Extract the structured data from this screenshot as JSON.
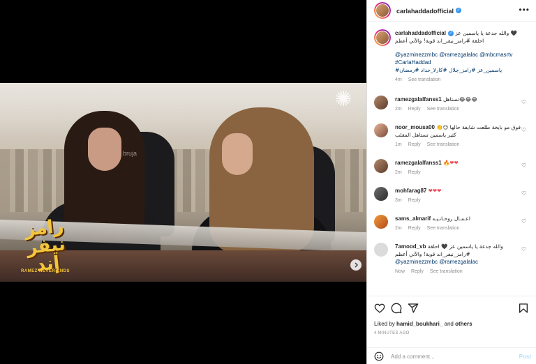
{
  "post": {
    "username": "carlahaddadofficial",
    "verified": true,
    "media": {
      "show_title": "رامز نيفر إند",
      "show_subtitle": "RAMEZ NEVER ENDS",
      "watermark_text": "bruja"
    }
  },
  "caption": {
    "username": "carlahaddadofficial",
    "line1": "والله جدعة يا ياسمين عز 🖤",
    "line2": "احلقة #رامز_نيفر_اند قوية! والآتي أعظم",
    "mentions": "@yazminezzmbc @ramezgalalac @mbcmasrtv",
    "tag1": "#CarlaHaddad",
    "tag2": "#ياسمين_عز #رامز_جلال #كارلا_حداد #رمضان",
    "time": "4m",
    "translation": "See translation"
  },
  "comments": [
    {
      "username": "ramezgalalfanss1",
      "text": "تستاهل😂😂😂",
      "time": "2m",
      "reply": "Reply",
      "translation": "See translation"
    },
    {
      "username": "noor_mousa00",
      "text": "فوق مو بايخة طلعت شايفة حالها 😏👏 كثير ياسمين تستاهل المقلب",
      "time": "1m",
      "reply": "Reply",
      "translation": "See translation"
    },
    {
      "username": "ramezgalalfanss1",
      "text": "🔥❤❤",
      "time": "2m",
      "reply": "Reply",
      "translation": ""
    },
    {
      "username": "mohfarag87",
      "text": "❤❤❤",
      "time": "3m",
      "reply": "Reply",
      "translation": ""
    },
    {
      "username": "sams_almarif",
      "text": "اعـمـال روحـانـيـه",
      "time": "2m",
      "reply": "Reply",
      "translation": "See translation"
    },
    {
      "username": "7amood_vb",
      "text": "والله جدعة يا ياسمين عز 🖤 احلقة #رامز_نيفر_اند قوية! والآتي أعظم",
      "mentions": "@yazminezzmbc @ramezgalalac",
      "time": "Now",
      "reply": "Reply",
      "translation": "See translation"
    }
  ],
  "actions": {
    "liked_by_prefix": "Liked by",
    "liked_by_user": "hamid_boukhari_",
    "liked_by_suffix": "and",
    "liked_by_others": "others",
    "timestamp": "4 MINUTES AGO",
    "add_comment_placeholder": "Add a comment...",
    "post_label": "Post"
  },
  "colors": {
    "link": "#00376b",
    "verified": "#3897f0",
    "post_button_disabled": "#b2dffc",
    "heart_red": "#ed4956"
  },
  "icons": [
    "more-options-icon",
    "heart-icon",
    "comment-icon",
    "share-icon",
    "save-icon",
    "emoji-icon",
    "next-arrow-icon",
    "user-tag-icon",
    "verified-badge-icon"
  ]
}
